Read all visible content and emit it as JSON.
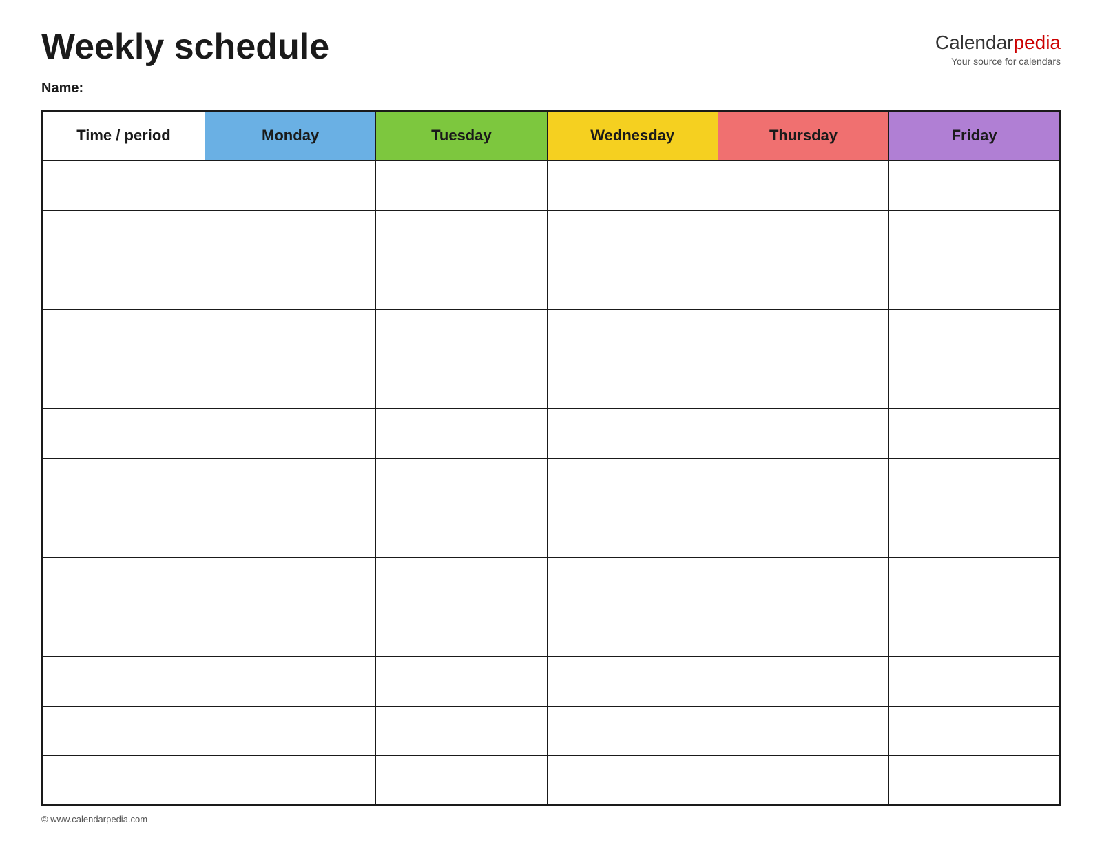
{
  "header": {
    "title": "Weekly schedule",
    "logo_calendar": "Calendar",
    "logo_pedia": "pedia",
    "logo_tagline": "Your source for calendars"
  },
  "name_label": "Name:",
  "table": {
    "columns": [
      {
        "key": "time",
        "label": "Time / period",
        "color": "#ffffff",
        "class": "th-time"
      },
      {
        "key": "monday",
        "label": "Monday",
        "color": "#6ab0e4",
        "class": "th-monday"
      },
      {
        "key": "tuesday",
        "label": "Tuesday",
        "color": "#7dc73e",
        "class": "th-tuesday"
      },
      {
        "key": "wednesday",
        "label": "Wednesday",
        "color": "#f5d020",
        "class": "th-wednesday"
      },
      {
        "key": "thursday",
        "label": "Thursday",
        "color": "#f07070",
        "class": "th-thursday"
      },
      {
        "key": "friday",
        "label": "Friday",
        "color": "#b07fd4",
        "class": "th-friday"
      }
    ],
    "row_count": 13
  },
  "footer": {
    "copyright": "© www.calendarpedia.com"
  }
}
